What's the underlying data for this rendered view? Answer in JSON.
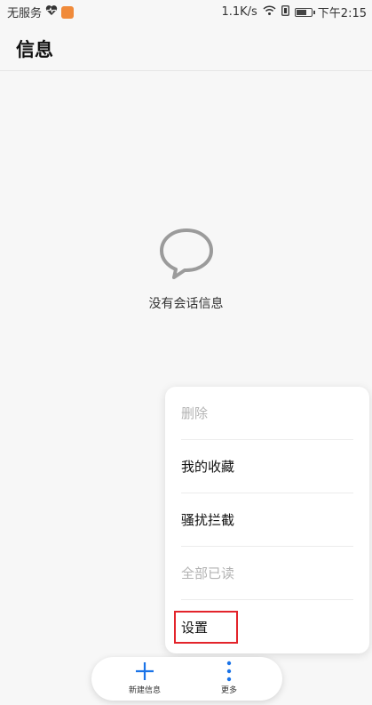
{
  "status_bar": {
    "carrier": "无服务",
    "speed": "1.1K/s",
    "time": "下午2:15",
    "icons": [
      "heart-pulse-icon",
      "app-badge-icon",
      "wifi-icon",
      "data-icon",
      "battery-icon"
    ]
  },
  "header": {
    "title": "信息"
  },
  "empty_state": {
    "icon": "chat-bubble-icon",
    "text": "没有会话信息"
  },
  "menu": {
    "items": [
      {
        "label": "删除",
        "enabled": false
      },
      {
        "label": "我的收藏",
        "enabled": true
      },
      {
        "label": "骚扰拦截",
        "enabled": true
      },
      {
        "label": "全部已读",
        "enabled": false
      },
      {
        "label": "设置",
        "enabled": true,
        "highlighted": true
      }
    ]
  },
  "bottom_bar": {
    "new_message_label": "新建信息",
    "more_label": "更多"
  },
  "colors": {
    "accent": "#1a73e8",
    "highlight": "#e3242b",
    "disabled_text": "#b3b3b3"
  }
}
